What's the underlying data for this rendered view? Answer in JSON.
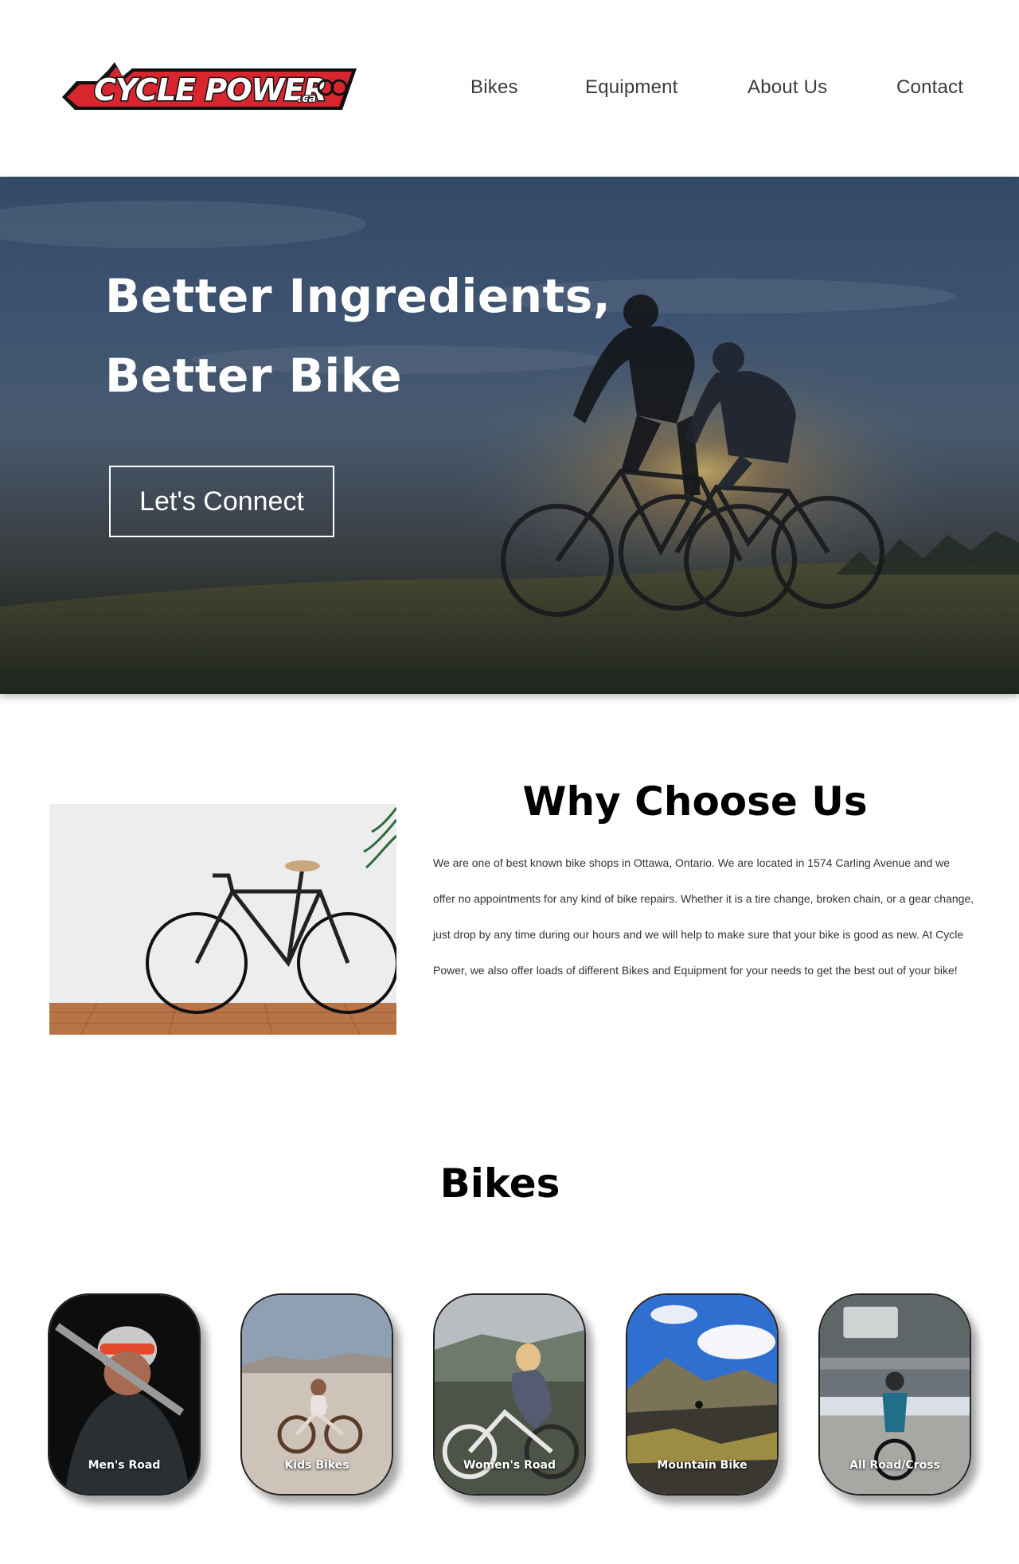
{
  "header": {
    "logo_text": "CYCLE POWER",
    "logo_suffix": ".ca",
    "nav": [
      {
        "label": "Bikes"
      },
      {
        "label": "Equipment"
      },
      {
        "label": "About Us"
      },
      {
        "label": "Contact"
      }
    ]
  },
  "hero": {
    "title_line1": "Better Ingredients,",
    "title_line2": "Better Bike",
    "cta_label": "Let's Connect"
  },
  "why": {
    "title": "Why Choose Us",
    "paragraph": "We are one of best known bike shops in Ottawa, Ontario. We are located in 1574 Carling Avenue and we offer no appointments for any kind of bike repairs. Whether it is a tire change, broken chain, or a gear change, just drop by any time during our hours and we will help to make sure that your bike is good as new.  At Cycle Power, we also offer loads of different Bikes and Equipment for your needs to get the best out of your bike!"
  },
  "bikes": {
    "title": "Bikes",
    "cards": [
      {
        "label": "Men's Road"
      },
      {
        "label": "Kids Bikes"
      },
      {
        "label": "Women's Road"
      },
      {
        "label": "Mountain Bike"
      },
      {
        "label": "All Road/Cross"
      }
    ]
  },
  "colors": {
    "brand_red": "#d7262e",
    "logo_black": "#111111",
    "text_dark": "#3b3b3b"
  }
}
